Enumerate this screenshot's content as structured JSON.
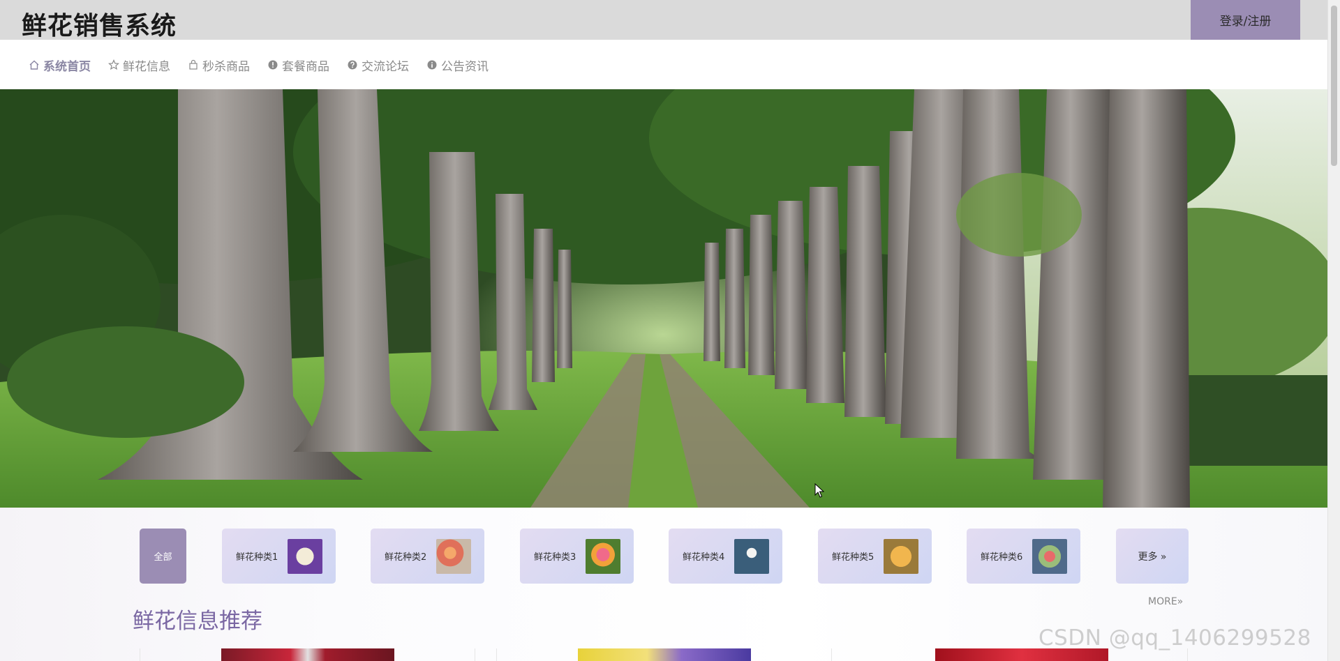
{
  "header": {
    "title": "鲜花销售系统",
    "login_label": "登录/注册"
  },
  "nav": {
    "items": [
      {
        "label": "系统首页",
        "icon": "home-icon",
        "active": true
      },
      {
        "label": "鲜花信息",
        "icon": "star-icon"
      },
      {
        "label": "秒杀商品",
        "icon": "bag-icon"
      },
      {
        "label": "套餐商品",
        "icon": "exclamation-circle-icon"
      },
      {
        "label": "交流论坛",
        "icon": "question-circle-icon"
      },
      {
        "label": "公告资讯",
        "icon": "info-circle-icon"
      }
    ]
  },
  "categories": {
    "all_label": "全部",
    "items": [
      {
        "label": "鲜花种类1"
      },
      {
        "label": "鲜花种类2"
      },
      {
        "label": "鲜花种类3"
      },
      {
        "label": "鲜花种类4"
      },
      {
        "label": "鲜花种类5"
      },
      {
        "label": "鲜花种类6"
      }
    ],
    "more_label": "更多 »"
  },
  "section": {
    "title": "鲜花信息推荐",
    "more_label": "MORE»"
  },
  "watermark": "CSDN @qq_1406299528",
  "colors": {
    "accent": "#9b8db4",
    "header_bg": "#dadada",
    "section_title": "#7a67a3"
  }
}
